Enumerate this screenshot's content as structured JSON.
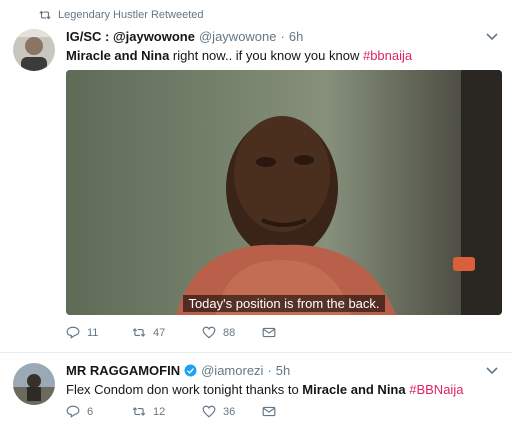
{
  "tweets": [
    {
      "retweet_notice": "Legendary Hustler Retweeted",
      "display_name": "IG/SC : @jaywowone",
      "handle": "@jaywowone",
      "separator": "·",
      "time": "6h",
      "text": {
        "bold": "Miracle and Nina",
        "plain": " right now.. if you know you know ",
        "hashtag": "#bbnaija"
      },
      "media_caption": "Today's position is from the back.",
      "counts": {
        "reply": "11",
        "retweet": "47",
        "like": "88"
      }
    },
    {
      "display_name": "MR RAGGAMOFIN",
      "handle": "@iamorezi",
      "separator": "·",
      "time": "5h",
      "verified": true,
      "text": {
        "plain": "Flex Condom don work tonight thanks to ",
        "bold": "Miracle and Nina",
        "hashtag": "#BBNaija"
      },
      "counts": {
        "reply": "6",
        "retweet": "12",
        "like": "36"
      }
    }
  ],
  "colors": {
    "accent": "#1da1f2",
    "hashtag": "#e0245e",
    "muted": "#657786",
    "text": "#14171a"
  },
  "icons": [
    "retweet-icon",
    "verified-icon",
    "chevron-down-icon",
    "reply-icon",
    "like-icon",
    "direct-message-icon"
  ]
}
